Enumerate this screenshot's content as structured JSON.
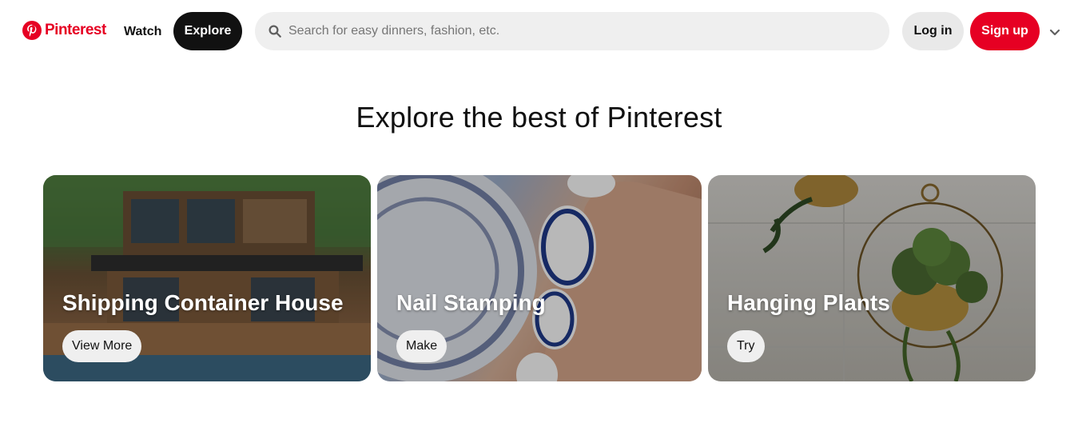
{
  "header": {
    "logo_text": "Pinterest",
    "nav_watch": "Watch",
    "nav_explore": "Explore",
    "search_placeholder": "Search for easy dinners, fashion, etc.",
    "login_label": "Log in",
    "signup_label": "Sign up",
    "menu_icon": "chevron-down-icon"
  },
  "colors": {
    "brand": "#e60023",
    "active_nav": "#111111",
    "search_bg": "#efefef"
  },
  "main": {
    "title": "Explore the best of Pinterest",
    "cards": [
      {
        "title": "Shipping Container House",
        "button": "View More"
      },
      {
        "title": "Nail Stamping",
        "button": "Make"
      },
      {
        "title": "Hanging Plants",
        "button": "Try"
      }
    ]
  }
}
